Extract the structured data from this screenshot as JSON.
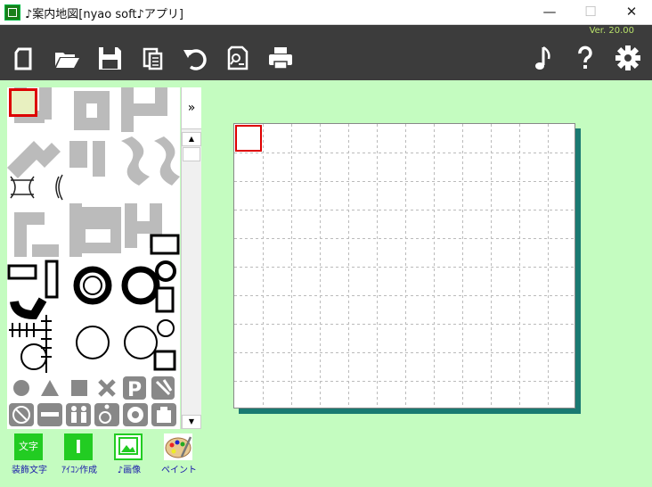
{
  "window": {
    "title": "♪案内地図[nyao soft♪アプリ]",
    "minimize": "—",
    "maximize": "☐",
    "close": "✕"
  },
  "toolbar": {
    "version": "Ver. 20.00",
    "buttons": [
      {
        "name": "new-icon"
      },
      {
        "name": "open-folder-icon"
      },
      {
        "name": "save-icon"
      },
      {
        "name": "paste-icon"
      },
      {
        "name": "undo-icon"
      },
      {
        "name": "search-document-icon"
      },
      {
        "name": "print-icon"
      },
      {
        "name": "music-note-icon"
      },
      {
        "name": "help-icon"
      },
      {
        "name": "settings-gear-icon"
      }
    ]
  },
  "palette": {
    "expand_label": "»",
    "scroll_up": "▲",
    "scroll_down": "▼"
  },
  "bottom_buttons": [
    {
      "label": "装飾文字",
      "icon_text": "文字"
    },
    {
      "label": "ｱｲｺﾝ作成",
      "icon_text": "I"
    },
    {
      "label": "♪画像",
      "icon_text": ""
    },
    {
      "label": "ペイント",
      "icon_text": ""
    }
  ],
  "colors": {
    "background": "#c4fcc0",
    "toolbar": "#3c3c3c",
    "version_text": "#b8e06a",
    "canvas_shadow": "#1a7a72",
    "selection": "#dd0000"
  }
}
